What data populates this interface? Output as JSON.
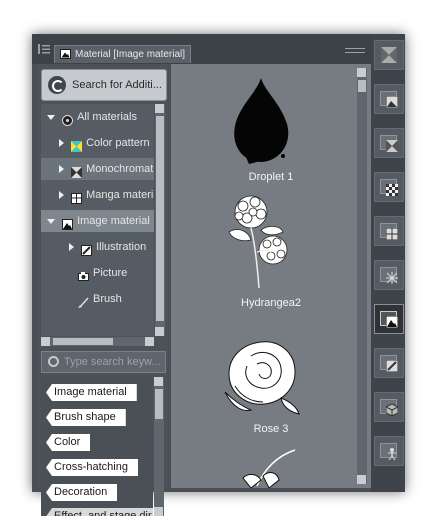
{
  "panel": {
    "tab_title": "Material [Image material]"
  },
  "search_button": {
    "label": "Search for Additi..."
  },
  "tree": {
    "items": [
      {
        "label": "All materials",
        "expanded": true,
        "icon": "disc-icon"
      },
      {
        "label": "Color pattern",
        "icon": "color-pattern-icon"
      },
      {
        "label": "Monochromatic",
        "icon": "monochromatic-icon"
      },
      {
        "label": "Manga material",
        "icon": "manga-material-icon"
      },
      {
        "label": "Image material",
        "icon": "image-material-icon"
      },
      {
        "label": "Illustration",
        "icon": "illustration-icon"
      },
      {
        "label": "Picture",
        "icon": "camera-icon"
      },
      {
        "label": "Brush",
        "icon": "brush-icon"
      }
    ]
  },
  "tag_search": {
    "placeholder": "Type search keyw..."
  },
  "tags": [
    "Image material",
    "Brush shape",
    "Color",
    "Cross-hatching",
    "Decoration",
    "Effect, and stage dir"
  ],
  "materials": [
    {
      "name": "Droplet 1"
    },
    {
      "name": "Hydrangea2"
    },
    {
      "name": "Rose 3"
    }
  ],
  "toolbar_icons": [
    "monochromatic-material-icon",
    "image-folder-icon",
    "pattern-folder-icon",
    "tone-folder-icon",
    "manga-folder-icon",
    "effect-folder-icon",
    "image-material-icon",
    "illustration-folder-icon",
    "3d-folder-icon",
    "figure-folder-icon"
  ]
}
